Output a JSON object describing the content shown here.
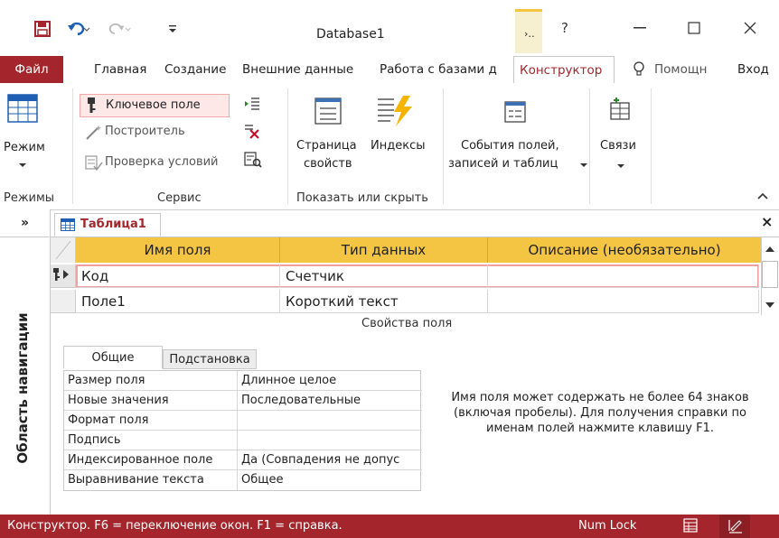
{
  "window": {
    "title": "Database1",
    "help_label": "?"
  },
  "tabs": [
    {
      "label": "Файл"
    },
    {
      "label": "Главная"
    },
    {
      "label": "Создание"
    },
    {
      "label": "Внешние данные"
    },
    {
      "label": "Работа с базами д"
    },
    {
      "label": "Конструктор"
    },
    {
      "label": "Помощн"
    },
    {
      "label": "Вход"
    }
  ],
  "ribbon": {
    "view": {
      "label": "Режим",
      "group": "Режимы"
    },
    "tools": {
      "primary_key": "Ключевое поле",
      "builder": "Построитель",
      "test_rules": "Проверка условий",
      "group": "Сервис"
    },
    "show_hide": {
      "property_sheet_line1": "Страница",
      "property_sheet_line2": "свойств",
      "indexes": "Индексы",
      "group": "Показать или скрыть"
    },
    "events": {
      "line1": "События полей,",
      "line2": "записей и таблиц"
    },
    "relationships": {
      "label": "Связи"
    }
  },
  "navigation_pane": {
    "toggle": "»",
    "label": "Область навигации"
  },
  "document": {
    "tab_label": "Таблица1",
    "close": "×"
  },
  "grid": {
    "headers": [
      "Имя поля",
      "Тип данных",
      "Описание (необязательно)"
    ],
    "rows": [
      {
        "name": "Код",
        "type": "Счетчик",
        "description": ""
      },
      {
        "name": "Поле1",
        "type": "Короткий текст",
        "description": ""
      }
    ]
  },
  "properties": {
    "section_label": "Свойства поля",
    "tab_general": "Общие",
    "tab_lookup": "Подстановка",
    "rows": [
      {
        "name": "Размер поля",
        "value": "Длинное целое"
      },
      {
        "name": "Новые значения",
        "value": "Последовательные"
      },
      {
        "name": "Формат поля",
        "value": ""
      },
      {
        "name": "Подпись",
        "value": ""
      },
      {
        "name": "Индексированное поле",
        "value": "Да (Совпадения не допус"
      },
      {
        "name": "Выравнивание текста",
        "value": "Общее"
      }
    ],
    "help": "Имя поля может содержать не более 64 знаков (включая пробелы). Для получения справки по именам полей нажмите клавишу F1."
  },
  "statusbar": {
    "text": "Конструктор.  F6 = переключение окон.  F1 = справка.",
    "numlock": "Num Lock"
  },
  "colors": {
    "accent": "#a4262c",
    "header": "#f4c542"
  }
}
